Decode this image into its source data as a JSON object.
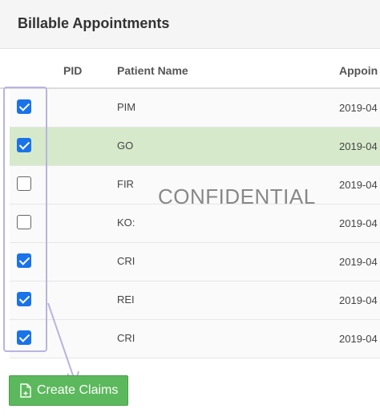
{
  "panel": {
    "title": "Billable Appointments"
  },
  "table": {
    "headers": {
      "pid": "PID",
      "patient_name": "Patient Name",
      "appointment": "Appoin"
    },
    "rows": [
      {
        "checked": true,
        "name": "PIM",
        "date": "2019-04"
      },
      {
        "checked": true,
        "name": "GO",
        "date": "2019-04"
      },
      {
        "checked": false,
        "name": "FIR",
        "date": "2019-04"
      },
      {
        "checked": false,
        "name": "KO:",
        "date": "2019-04"
      },
      {
        "checked": true,
        "name": "CRI",
        "date": "2019-04"
      },
      {
        "checked": true,
        "name": "REI",
        "date": "2019-04"
      },
      {
        "checked": true,
        "name": "CRI",
        "date": "2019-04"
      }
    ]
  },
  "watermark": "CONFIDENTIAL",
  "actions": {
    "create_claims_label": "Create Claims",
    "create_claims_icon": "document-plus-icon"
  },
  "colors": {
    "checkbox_checked": "#1a73e8",
    "selected_row": "#d6eacb",
    "button_green": "#5cb85c",
    "annotation": "#b9b3e0"
  }
}
